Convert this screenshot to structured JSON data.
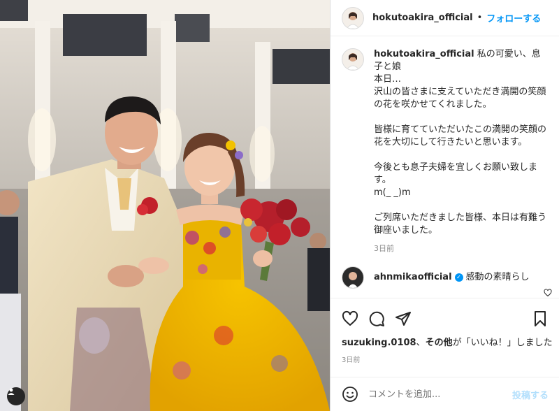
{
  "header": {
    "username": "hokutoakira_official",
    "separator": "•",
    "follow_label": "フォローする"
  },
  "caption": {
    "username": "hokutoakira_official",
    "text": "私の可愛い、息子と娘\n本日…\n沢山の皆さまに支えていただき満開の笑顔の花を咲かせてくれました。\n\n皆様に育てていただいたこの満開の笑顔の花を大切にして行きたいと思います。\n\n今後とも息子夫婦を宜しくお願い致します。\nm(_ _)m\n\nご列席いただきました皆様、本日は有難う御座いました。",
    "time": "3日前"
  },
  "comment": {
    "username": "ahnmikaofficial",
    "text": "感動の素晴らし"
  },
  "likes": {
    "user": "suzuking.0108",
    "connector": "、",
    "others": "その他",
    "suffix": "が「いいね！」しました"
  },
  "post_time": "3日前",
  "add_comment": {
    "placeholder": "コメントを追加...",
    "post_label": "投稿する"
  },
  "icons": {
    "like": "heart-icon",
    "comment": "comment-icon",
    "share": "share-icon",
    "save": "bookmark-icon",
    "emoji": "emoji-icon",
    "user_tag": "user-tag-icon"
  },
  "colors": {
    "accent": "#0095f6",
    "post_disabled": "#b2dffc",
    "verified": "#0095f6",
    "muted": "#8e8e8e"
  }
}
